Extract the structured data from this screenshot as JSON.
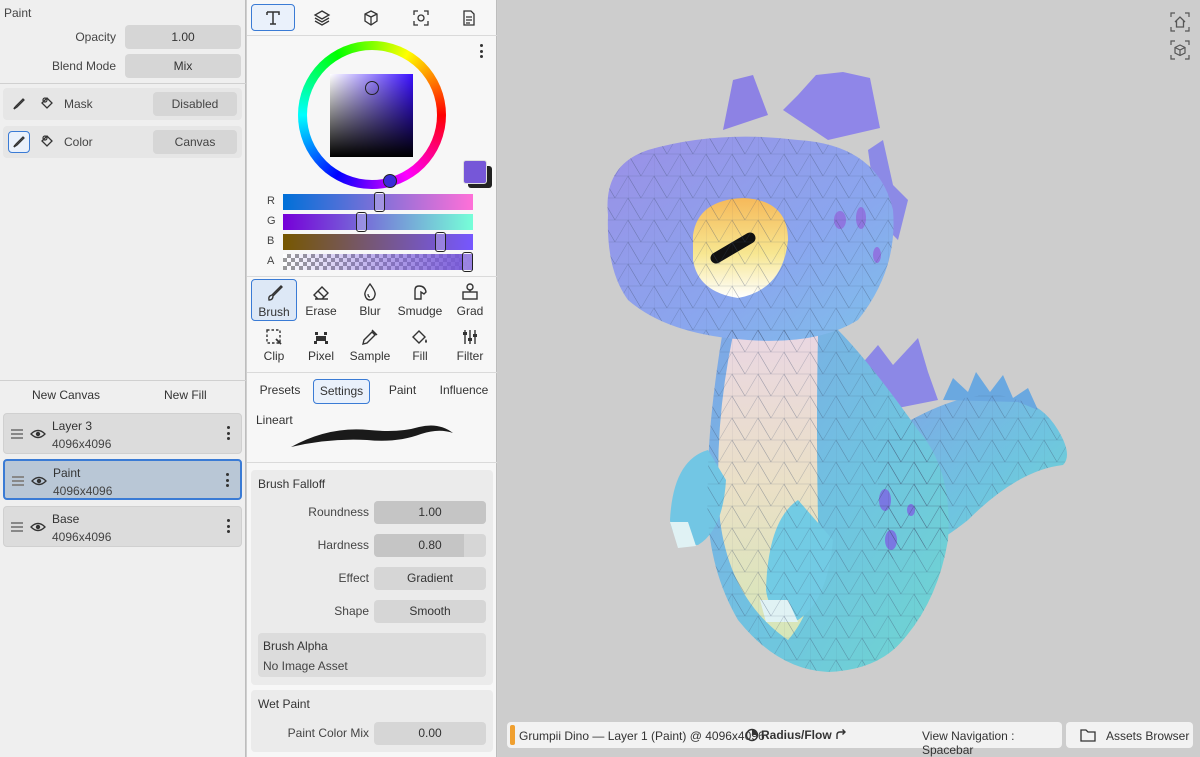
{
  "paint_props": {
    "title": "Paint",
    "opacity_label": "Opacity",
    "opacity_value": "1.00",
    "blend_label": "Blend Mode",
    "blend_value": "Mix"
  },
  "channels": {
    "mask": {
      "label": "Mask",
      "value": "Disabled"
    },
    "color": {
      "label": "Color",
      "value": "Canvas"
    }
  },
  "layer_actions": {
    "new_canvas": "New Canvas",
    "new_fill": "New Fill"
  },
  "layers": [
    {
      "name": "Layer 3",
      "size": "4096x4096",
      "selected": false
    },
    {
      "name": "Paint",
      "size": "4096x4096",
      "selected": true
    },
    {
      "name": "Base",
      "size": "4096x4096",
      "selected": false
    }
  ],
  "color": {
    "current_hex": "#7657d8",
    "sliders": [
      {
        "label": "R",
        "value": 0.51
      },
      {
        "label": "G",
        "value": 0.41
      },
      {
        "label": "B",
        "value": 0.85
      },
      {
        "label": "A",
        "value": 1.0
      }
    ]
  },
  "tools": [
    {
      "label": "Brush",
      "icon": "brush-icon",
      "active": true
    },
    {
      "label": "Erase",
      "icon": "eraser-icon",
      "active": false
    },
    {
      "label": "Blur",
      "icon": "blur-drop-icon",
      "active": false
    },
    {
      "label": "Smudge",
      "icon": "smudge-icon",
      "active": false
    },
    {
      "label": "Grad",
      "icon": "gradient-icon",
      "active": false
    },
    {
      "label": "Clip",
      "icon": "clip-icon",
      "active": false
    },
    {
      "label": "Pixel",
      "icon": "pixel-icon",
      "active": false
    },
    {
      "label": "Sample",
      "icon": "eyedropper-icon",
      "active": false
    },
    {
      "label": "Fill",
      "icon": "fill-bucket-icon",
      "active": false
    },
    {
      "label": "Filter",
      "icon": "filter-sliders-icon",
      "active": false
    }
  ],
  "subtabs": {
    "presets": "Presets",
    "settings": "Settings",
    "paint": "Paint",
    "influence": "Influence"
  },
  "lineart_label": "Lineart",
  "brush_falloff": {
    "title": "Brush Falloff",
    "roundness_label": "Roundness",
    "roundness_value": "1.00",
    "roundness_fraction": 1.0,
    "hardness_label": "Hardness",
    "hardness_value": "0.80",
    "hardness_fraction": 0.8,
    "effect_label": "Effect",
    "effect_value": "Gradient",
    "shape_label": "Shape",
    "shape_value": "Smooth",
    "alpha_title": "Brush Alpha",
    "alpha_value": "No Image Asset"
  },
  "wet_paint": {
    "title": "Wet Paint",
    "mix_label": "Paint Color Mix",
    "mix_value": "0.00"
  },
  "status": {
    "document": "Grumpii Dino — Layer 1 (Paint) @ 4096x4096",
    "radius_flow": "Radius/Flow",
    "nav_hint": "View Navigation : Spacebar",
    "assets": "Assets Browser"
  },
  "accent_color": "#3a7bd5"
}
